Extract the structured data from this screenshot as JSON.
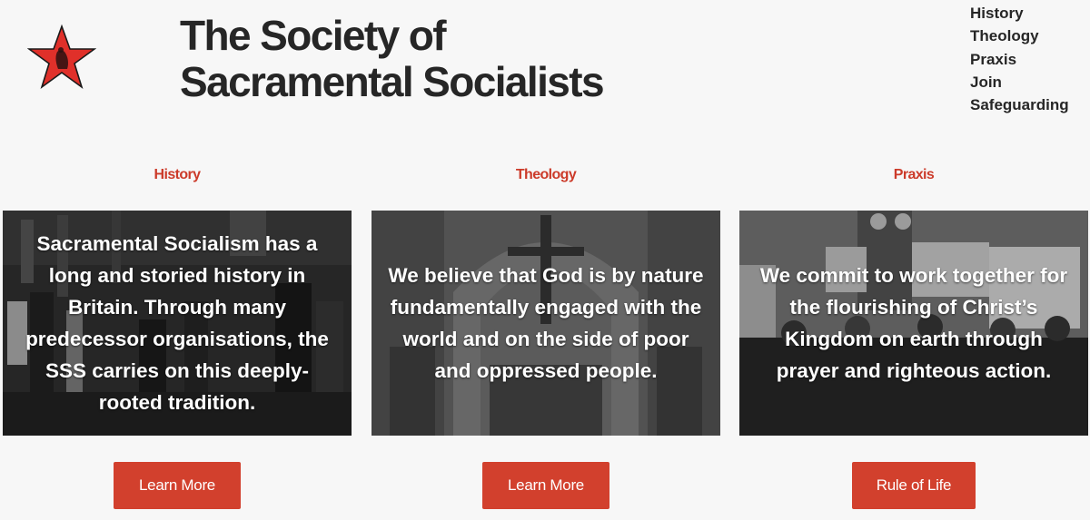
{
  "site": {
    "title_line1": "The Society of",
    "title_line2": "Sacramental Socialists",
    "logo": "red-star-emblem-icon",
    "accent_color": "#d2402d",
    "heading_color": "#cc3b2a"
  },
  "nav": {
    "items": [
      "History",
      "Theology",
      "Praxis",
      "Join",
      "Safeguarding"
    ]
  },
  "columns": [
    {
      "heading": "History",
      "text": "Sacramental Socialism has a long and storied history in Britain. Through many predecessor organisations, the SSS carries on this deeply-rooted tradition.",
      "button": "Learn More",
      "image": "procession-of-clergy-photo"
    },
    {
      "heading": "Theology",
      "text": "We believe that God is by nature fundamentally engaged with the world and on the side of poor and oppressed people.",
      "button": "Learn More",
      "image": "church-interior-crucifix-photo"
    },
    {
      "heading": "Praxis",
      "text": "We commit to work together for the flourishing of Christ’s Kingdom on earth through prayer and righteous action.",
      "button": "Rule of Life",
      "image": "protest-near-big-ben-photo"
    }
  ]
}
